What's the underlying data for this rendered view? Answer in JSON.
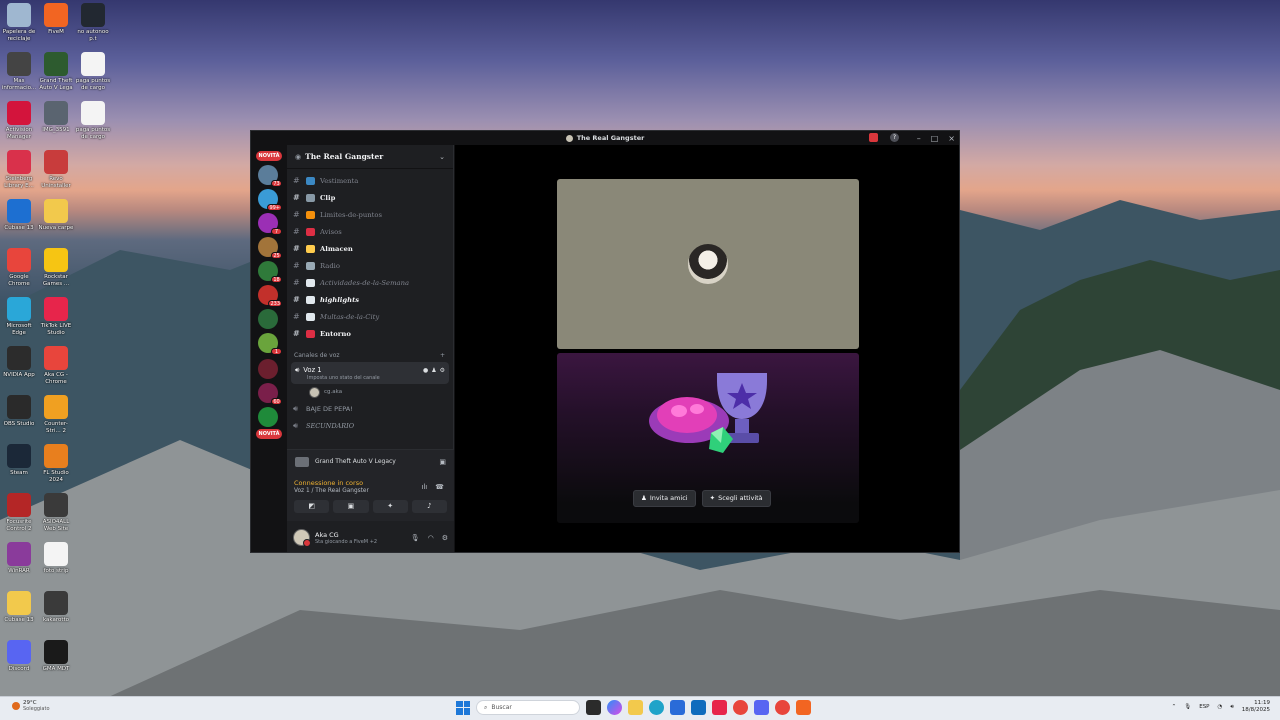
{
  "desktop_icons": [
    {
      "label": "Papelera de reciclaje",
      "icon": "recycle-bin-icon",
      "color": "#9fb7d0"
    },
    {
      "label": "FiveM",
      "icon": "fivem-icon",
      "color": "#f26522"
    },
    {
      "label": "no autonoo p.t",
      "icon": "shortcut-icon",
      "color": "#222831"
    },
    {
      "label": "Mas informacio...",
      "icon": "info-icon",
      "color": "#444"
    },
    {
      "label": "Grand Theft Auto V Lega",
      "icon": "gta-icon",
      "color": "#2d5b2f"
    },
    {
      "label": "paga puntos de cargo",
      "icon": "document-icon",
      "color": "#f4f4f4"
    },
    {
      "label": "Activision Manager",
      "icon": "activision-icon",
      "color": "#d3143c"
    },
    {
      "label": "IMG_3591",
      "icon": "image-icon",
      "color": "#5a6470"
    },
    {
      "label": "paga puntos de cargo",
      "icon": "document-icon",
      "color": "#f4f4f4"
    },
    {
      "label": "Steinberg Library E...",
      "icon": "steinberg-icon",
      "color": "#d9314b"
    },
    {
      "label": "Revo Uninstaller",
      "icon": "revo-icon",
      "color": "#c83c3c"
    },
    {
      "label": "Cubase 13",
      "icon": "cubase-icon",
      "color": "#1d6fd1"
    },
    {
      "label": "Nueva carpe",
      "icon": "folder-icon",
      "color": "#f2c94c"
    },
    {
      "label": "Google Chrome",
      "icon": "chrome-icon",
      "color": "#e8453c"
    },
    {
      "label": "Rockstar Games ...",
      "icon": "rockstar-icon",
      "color": "#f6c513"
    },
    {
      "label": "Microsoft Edge",
      "icon": "edge-icon",
      "color": "#2aa7d8"
    },
    {
      "label": "TikTok LIVE Studio",
      "icon": "tiktok-icon",
      "color": "#e7254b"
    },
    {
      "label": "NVIDIA App",
      "icon": "nvidia-icon",
      "color": "#2c2c2c"
    },
    {
      "label": "Aka CG - Chrome",
      "icon": "chrome-icon",
      "color": "#e8453c"
    },
    {
      "label": "OBS Studio",
      "icon": "obs-icon",
      "color": "#2a2a2a"
    },
    {
      "label": "Counter-Stri... 2",
      "icon": "cs2-icon",
      "color": "#f0a021"
    },
    {
      "label": "Steam",
      "icon": "steam-icon",
      "color": "#1b2838"
    },
    {
      "label": "FL Studio 2024",
      "icon": "flstudio-icon",
      "color": "#e87f1e"
    },
    {
      "label": "Focusrite Control 2",
      "icon": "focusrite-icon",
      "color": "#b42626"
    },
    {
      "label": "ASIO4ALL Web Site",
      "icon": "asio-icon",
      "color": "#3a3a3a"
    },
    {
      "label": "WinRAR",
      "icon": "winrar-icon",
      "color": "#8a3b9b"
    },
    {
      "label": "foto strip",
      "icon": "document-icon",
      "color": "#f4f4f4"
    },
    {
      "label": "Cubase 13",
      "icon": "folder-icon",
      "color": "#f2c94c"
    },
    {
      "label": "kakarotto",
      "icon": "image-icon",
      "color": "#3a3a3a"
    },
    {
      "label": "Discord",
      "icon": "discord-icon",
      "color": "#5865f2"
    },
    {
      "label": "GMA MDT",
      "icon": "image-icon",
      "color": "#1a1a1a"
    }
  ],
  "window": {
    "title": "The Real Gangster",
    "server_name": "The Real Gangster",
    "novita_label": "NOVITÀ",
    "rail_badges": [
      "73",
      "99+",
      "7",
      "25",
      "18",
      "233",
      "1",
      "60"
    ],
    "channels": [
      {
        "name": "Vestimenta",
        "emoji_color": "#3b88c3",
        "unread": false
      },
      {
        "name": "Clip",
        "emoji_color": "#8899a6",
        "unread": true
      },
      {
        "name": "Limites-de-puntos",
        "emoji_color": "#f4900c",
        "unread": false
      },
      {
        "name": "Avisos",
        "emoji_color": "#dd2e44",
        "unread": false
      },
      {
        "name": "Almacen",
        "emoji_color": "#ffcc4d",
        "unread": true
      },
      {
        "name": "Radio",
        "emoji_color": "#99aab5",
        "unread": false
      },
      {
        "name": "Actividades-de-la-Semana",
        "emoji_color": "#e1e8ed",
        "unread": false
      },
      {
        "name": "highlights",
        "emoji_color": "#e1e8ed",
        "unread": true
      },
      {
        "name": "Multas-de-la-City",
        "emoji_color": "#e1e8ed",
        "unread": false
      },
      {
        "name": "Entorno",
        "emoji_color": "#dd2e44",
        "unread": true
      }
    ],
    "voice_category": "Canales de voz",
    "voice_active": {
      "name": "Voz 1",
      "status": "Imposta uno stato del canale"
    },
    "voice_user": "cg.aka",
    "voice_channels": [
      "BAJE DE PEPA!",
      "SECUNDARIO"
    ],
    "activity_game": "Grand Theft Auto V Legacy",
    "connection_status": "Connessione in corso",
    "connection_path": "Voz 1 / The Real Gangster",
    "user_name": "Aka CG",
    "user_status": "Sta giocando a FiveM +2",
    "invite_label": "Invita amici",
    "choose_activity_label": "Scegli attività"
  },
  "taskbar": {
    "weather_temp": "29°C",
    "weather_desc": "Soleggiato",
    "search_placeholder": "Buscar",
    "language": "ESP",
    "time": "11:19",
    "date": "18/8/2025"
  },
  "colors": {
    "discord_bg": "#121214",
    "accent_red": "#da373c",
    "connecting_orange": "#f0b232"
  }
}
